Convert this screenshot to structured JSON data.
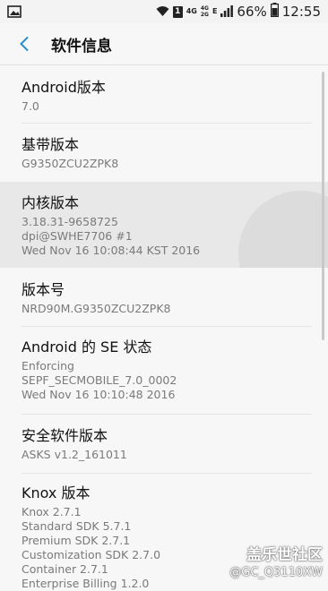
{
  "status_bar": {
    "left_icon": "image-icon",
    "sim": "1",
    "network_top": "4G",
    "network_mid": "4G",
    "network_bot": "2G",
    "signal_letter": "E",
    "battery": "66%",
    "time": "12:55"
  },
  "app_bar": {
    "title": "软件信息"
  },
  "items": [
    {
      "label": "Android版本",
      "values": [
        "7.0"
      ]
    },
    {
      "label": "基带版本",
      "values": [
        "G9350ZCU2ZPK8"
      ]
    },
    {
      "label": "内核版本",
      "values": [
        "3.18.31-9658725",
        "dpi@SWHE7706 #1",
        "Wed Nov 16 10:08:44 KST 2016"
      ]
    },
    {
      "label": "版本号",
      "values": [
        "NRD90M.G9350ZCU2ZPK8"
      ]
    },
    {
      "label": "Android 的 SE 状态",
      "values": [
        "Enforcing",
        "SEPF_SECMOBILE_7.0_0002",
        "Wed Nov 16 10:10:48 2016"
      ]
    },
    {
      "label": "安全软件版本",
      "values": [
        "ASKS v1.2_161011"
      ]
    },
    {
      "label": "Knox 版本",
      "values": [
        "Knox 2.7.1",
        "Standard SDK 5.7.1",
        "Premium SDK 2.7.1",
        "Customization SDK 2.7.0",
        "Container 2.7.1",
        "Enterprise Billing 1.2.0"
      ]
    }
  ],
  "watermark": {
    "line1": "盖乐世社区",
    "line2": "@GC_Q3110XW"
  }
}
